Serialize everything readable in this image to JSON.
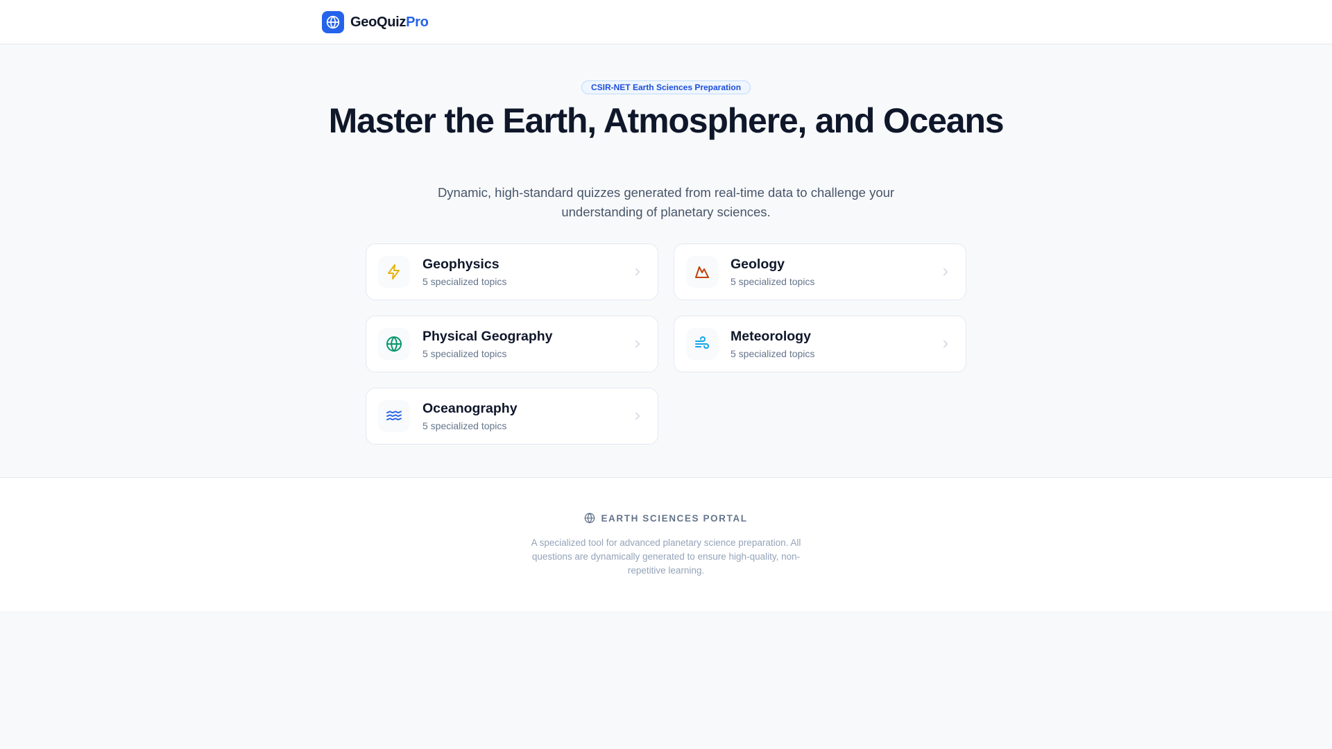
{
  "header": {
    "brand_main": "GeoQuiz",
    "brand_accent": "Pro",
    "logo_icon": "globe-icon",
    "accent_color": "#2563eb"
  },
  "hero": {
    "badge": "CSIR-NET Earth Sciences Preparation",
    "title": "Master the Earth, Atmosphere, and Oceans",
    "subtitle": "Dynamic, high-standard quizzes generated from real-time data to challenge your understanding of planetary sciences."
  },
  "categories": [
    {
      "title": "Geophysics",
      "meta": "5 specialized topics",
      "icon": "lightning-icon",
      "icon_color": "#eab308"
    },
    {
      "title": "Geology",
      "meta": "5 specialized topics",
      "icon": "mountain-icon",
      "icon_color": "#c2410c"
    },
    {
      "title": "Physical Geography",
      "meta": "5 specialized topics",
      "icon": "globe-icon",
      "icon_color": "#059669"
    },
    {
      "title": "Meteorology",
      "meta": "5 specialized topics",
      "icon": "wind-icon",
      "icon_color": "#0ea5e9"
    },
    {
      "title": "Oceanography",
      "meta": "5 specialized topics",
      "icon": "waves-icon",
      "icon_color": "#2563eb"
    }
  ],
  "footer": {
    "heading": "EARTH SCIENCES PORTAL",
    "icon": "globe-icon",
    "text": "A specialized tool for advanced planetary science preparation. All questions are dynamically generated to ensure high-quality, non-repetitive learning."
  }
}
